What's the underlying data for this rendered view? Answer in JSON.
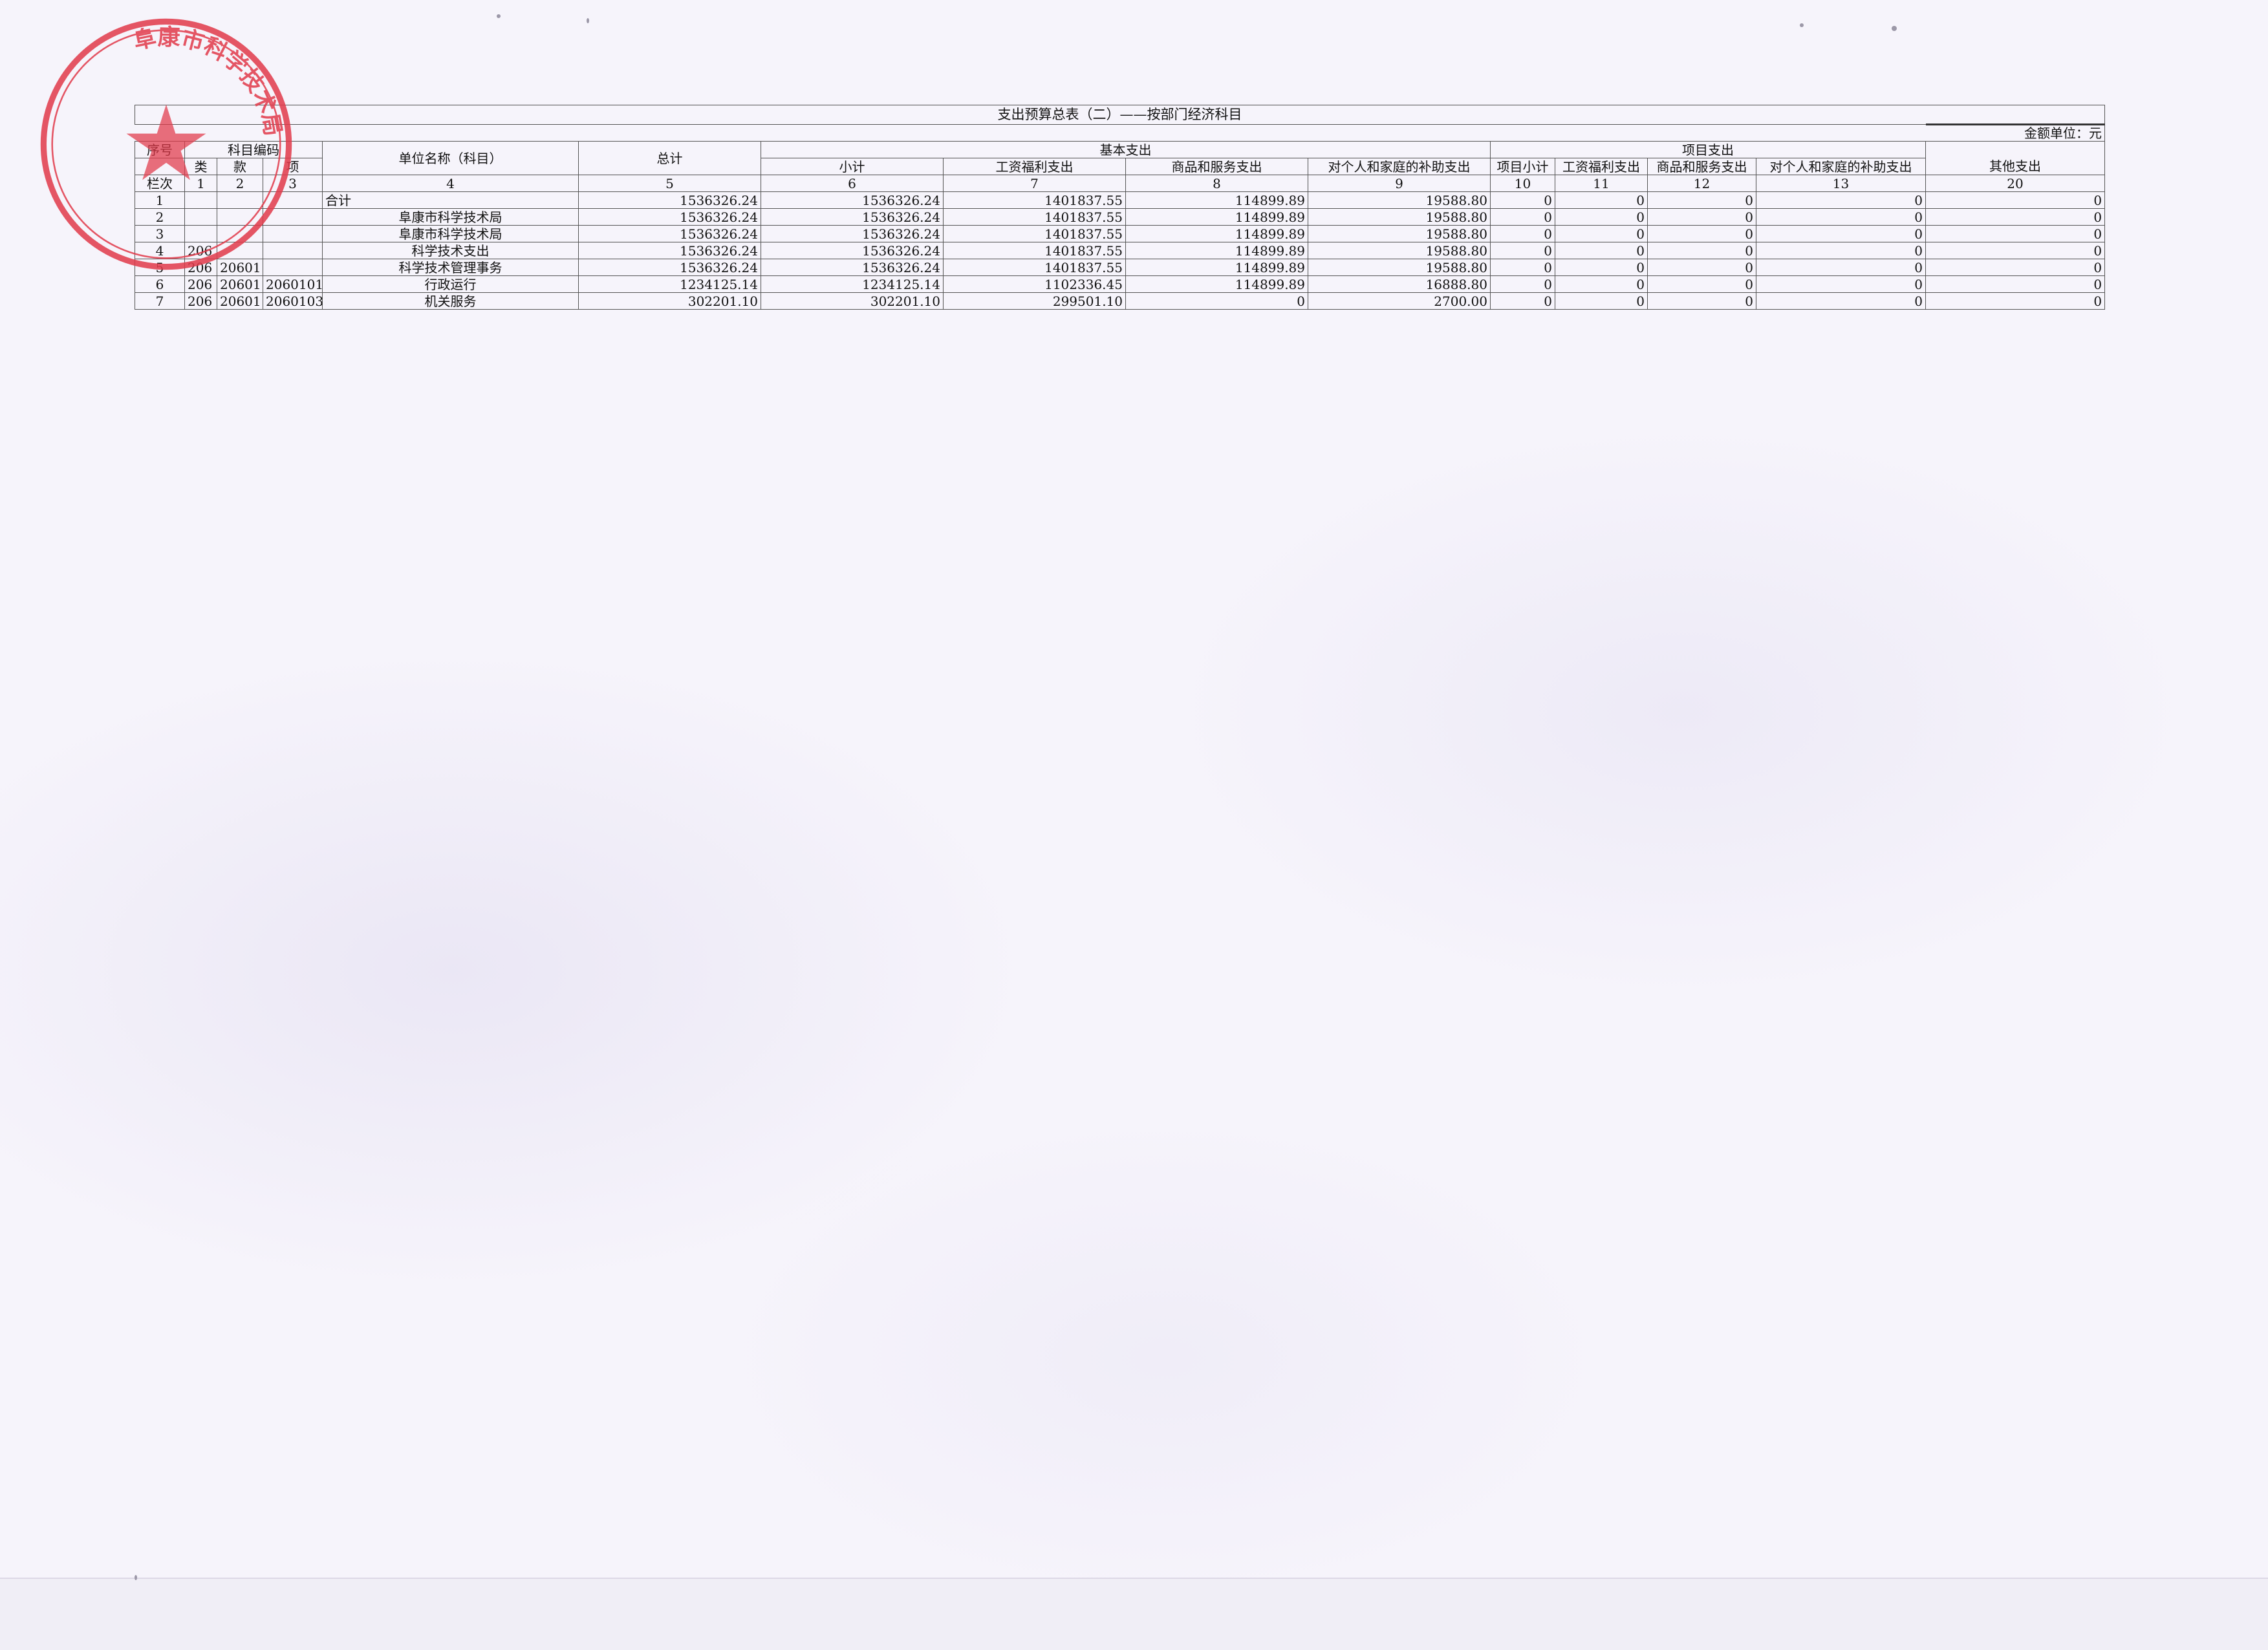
{
  "document": {
    "title": "支出预算总表（二）——按部门经济科目",
    "unit_label": "金额单位：元"
  },
  "header": {
    "seq": "序号",
    "subject_code": "科目编码",
    "class": "类",
    "section": "款",
    "item": "项",
    "unit_name": "单位名称（科目）",
    "total": "总计",
    "basic": "基本支出",
    "basic_subtotal": "小计",
    "basic_wage": "工资福利支出",
    "basic_goods": "商品和服务支出",
    "basic_subsidy": "对个人和家庭的补助支出",
    "project": "项目支出",
    "project_subtotal": "项目小计",
    "project_wage": "工资福利支出",
    "project_goods": "商品和服务支出",
    "project_subsidy": "对个人和家庭的补助支出",
    "other": "其他支出"
  },
  "col_numbers": [
    "栏次",
    "1",
    "2",
    "3",
    "4",
    "5",
    "6",
    "7",
    "8",
    "9",
    "10",
    "11",
    "12",
    "13",
    "20"
  ],
  "rows": [
    {
      "seq": "1",
      "cls": "",
      "sec": "",
      "itm": "",
      "name": "合计",
      "align": "left",
      "total": "1536326.24",
      "b_sub": "1536326.24",
      "b_wage": "1401837.55",
      "b_goods": "114899.89",
      "b_subsidy": "19588.80",
      "p_sub": "0",
      "p_wage": "0",
      "p_goods": "0",
      "p_subsidy": "0",
      "other": "0"
    },
    {
      "seq": "2",
      "cls": "",
      "sec": "",
      "itm": "",
      "name": "阜康市科学技术局",
      "align": "center",
      "total": "1536326.24",
      "b_sub": "1536326.24",
      "b_wage": "1401837.55",
      "b_goods": "114899.89",
      "b_subsidy": "19588.80",
      "p_sub": "0",
      "p_wage": "0",
      "p_goods": "0",
      "p_subsidy": "0",
      "other": "0"
    },
    {
      "seq": "3",
      "cls": "",
      "sec": "",
      "itm": "",
      "name": "阜康市科学技术局",
      "align": "center",
      "total": "1536326.24",
      "b_sub": "1536326.24",
      "b_wage": "1401837.55",
      "b_goods": "114899.89",
      "b_subsidy": "19588.80",
      "p_sub": "0",
      "p_wage": "0",
      "p_goods": "0",
      "p_subsidy": "0",
      "other": "0"
    },
    {
      "seq": "4",
      "cls": "206",
      "sec": "",
      "itm": "",
      "name": "科学技术支出",
      "align": "center",
      "total": "1536326.24",
      "b_sub": "1536326.24",
      "b_wage": "1401837.55",
      "b_goods": "114899.89",
      "b_subsidy": "19588.80",
      "p_sub": "0",
      "p_wage": "0",
      "p_goods": "0",
      "p_subsidy": "0",
      "other": "0"
    },
    {
      "seq": "5",
      "cls": "206",
      "sec": "20601",
      "itm": "",
      "name": "科学技术管理事务",
      "align": "center",
      "total": "1536326.24",
      "b_sub": "1536326.24",
      "b_wage": "1401837.55",
      "b_goods": "114899.89",
      "b_subsidy": "19588.80",
      "p_sub": "0",
      "p_wage": "0",
      "p_goods": "0",
      "p_subsidy": "0",
      "other": "0"
    },
    {
      "seq": "6",
      "cls": "206",
      "sec": "20601",
      "itm": "2060101",
      "name": "行政运行",
      "align": "center",
      "total": "1234125.14",
      "b_sub": "1234125.14",
      "b_wage": "1102336.45",
      "b_goods": "114899.89",
      "b_subsidy": "16888.80",
      "p_sub": "0",
      "p_wage": "0",
      "p_goods": "0",
      "p_subsidy": "0",
      "other": "0"
    },
    {
      "seq": "7",
      "cls": "206",
      "sec": "20601",
      "itm": "2060103",
      "name": "机关服务",
      "align": "center",
      "total": "302201.10",
      "b_sub": "302201.10",
      "b_wage": "299501.10",
      "b_goods": "0",
      "b_subsidy": "2700.00",
      "p_sub": "0",
      "p_wage": "0",
      "p_goods": "0",
      "p_subsidy": "0",
      "other": "0"
    }
  ],
  "seal": {
    "description_color": "#e02a3a",
    "text": "阜康市科学技术局"
  }
}
